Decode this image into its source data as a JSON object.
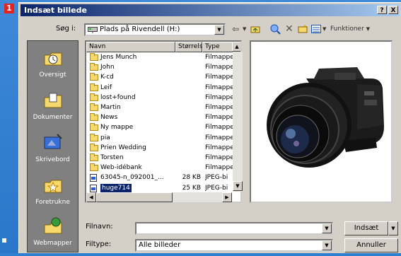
{
  "step_number": "1",
  "window": {
    "title": "Indsæt billede",
    "help_btn": "?",
    "close_btn": "X"
  },
  "lookin": {
    "label": "Søg i:",
    "value": "Plads på Rivendell (H:)"
  },
  "toolbar": {
    "tools_label": "Funktioner"
  },
  "places": [
    {
      "label": "Oversigt",
      "icon": "history-icon"
    },
    {
      "label": "Dokumenter",
      "icon": "documents-icon"
    },
    {
      "label": "Skrivebord",
      "icon": "desktop-icon"
    },
    {
      "label": "Foretrukne",
      "icon": "favorites-icon"
    },
    {
      "label": "Webmapper",
      "icon": "web-folders-icon"
    }
  ],
  "columns": {
    "name": "Navn",
    "size": "Størrelse",
    "type": "Type"
  },
  "files": [
    {
      "name": "Jens Munch",
      "size": "",
      "type": "Filmappe",
      "kind": "folder"
    },
    {
      "name": "John",
      "size": "",
      "type": "Filmappe",
      "kind": "folder"
    },
    {
      "name": "K-cd",
      "size": "",
      "type": "Filmappe",
      "kind": "folder"
    },
    {
      "name": "Leif",
      "size": "",
      "type": "Filmappe",
      "kind": "folder"
    },
    {
      "name": "lost+found",
      "size": "",
      "type": "Filmappe",
      "kind": "folder"
    },
    {
      "name": "Martin",
      "size": "",
      "type": "Filmappe",
      "kind": "folder"
    },
    {
      "name": "News",
      "size": "",
      "type": "Filmappe",
      "kind": "folder"
    },
    {
      "name": "Ny mappe",
      "size": "",
      "type": "Filmappe",
      "kind": "folder"
    },
    {
      "name": "pia",
      "size": "",
      "type": "Filmappe",
      "kind": "folder"
    },
    {
      "name": "Prien Wedding",
      "size": "",
      "type": "Filmappe",
      "kind": "folder"
    },
    {
      "name": "Torsten",
      "size": "",
      "type": "Filmappe",
      "kind": "folder"
    },
    {
      "name": "Web-idébank",
      "size": "",
      "type": "Filmappe",
      "kind": "folder"
    },
    {
      "name": "63045-n_092001_...",
      "size": "28 KB",
      "type": "JPEG-bi",
      "kind": "image"
    },
    {
      "name": "huge714",
      "size": "25 KB",
      "type": "JPEG-bi",
      "kind": "image",
      "selected": true
    }
  ],
  "filename": {
    "label": "Filnavn:",
    "value": ""
  },
  "filetype": {
    "label": "Filtype:",
    "value": "Alle billeder"
  },
  "buttons": {
    "insert": "Indsæt",
    "cancel": "Annuller"
  }
}
